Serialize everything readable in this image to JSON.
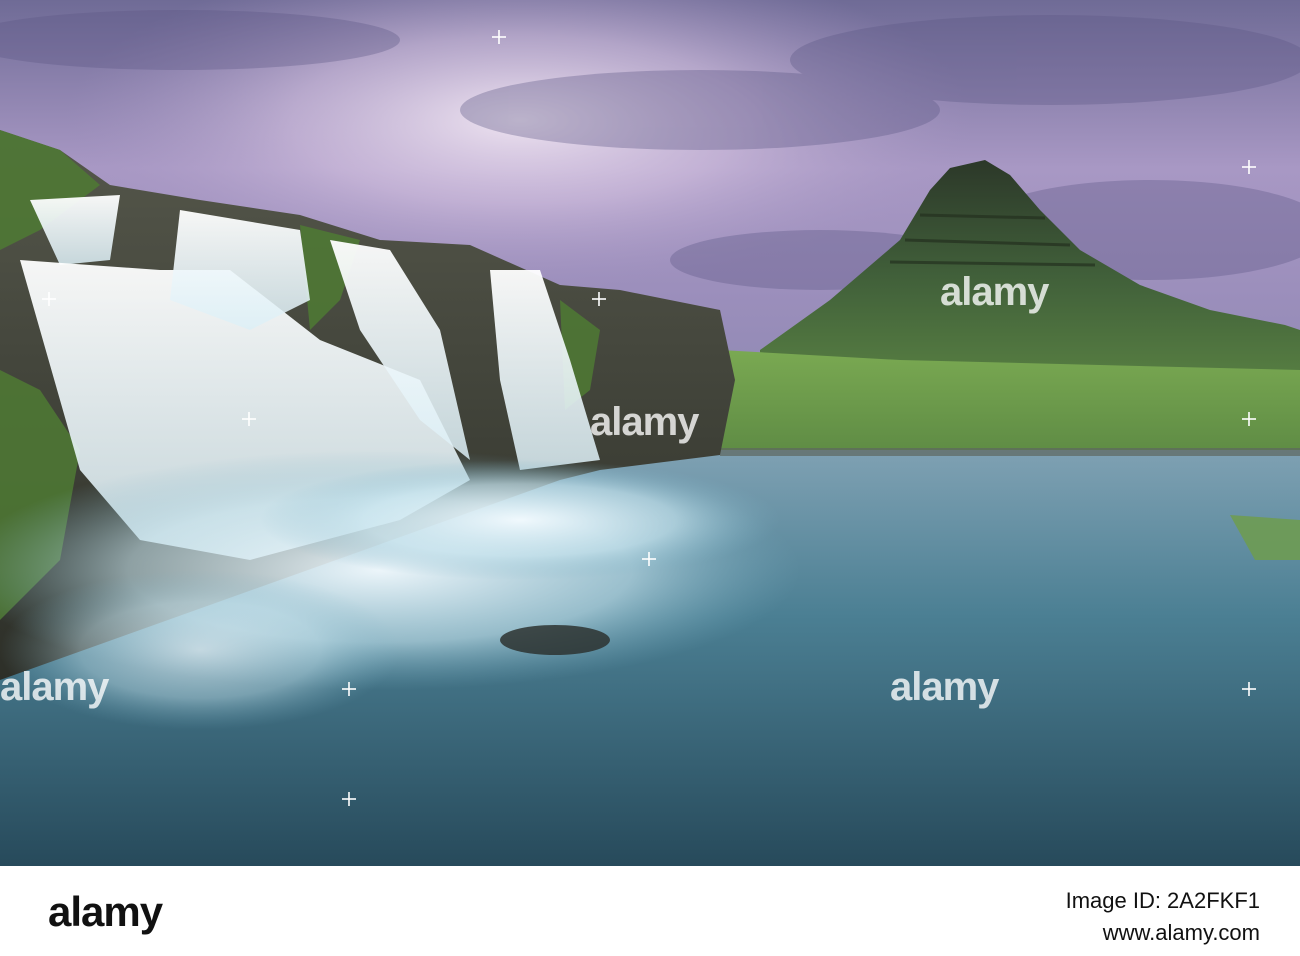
{
  "photo": {
    "subject": "Kirkjufell mountain and Kirkjufellsfoss waterfall at dusk",
    "colors": {
      "sky_top": "#6d6a93",
      "sky_mid": "#b9a6cc",
      "sky_glow": "#e8dbef",
      "mountain": "#3f5a31",
      "mountain_dark": "#2b3a26",
      "grass": "#6d9b48",
      "water": "#3f6e80",
      "water_foam": "#e6f2f7",
      "rock": "#3d3f36"
    }
  },
  "watermark": {
    "text": "alamy"
  },
  "footer": {
    "logo": "alamy",
    "image_id_label": "Image ID: 2A2FKF1",
    "url": "www.alamy.com"
  }
}
